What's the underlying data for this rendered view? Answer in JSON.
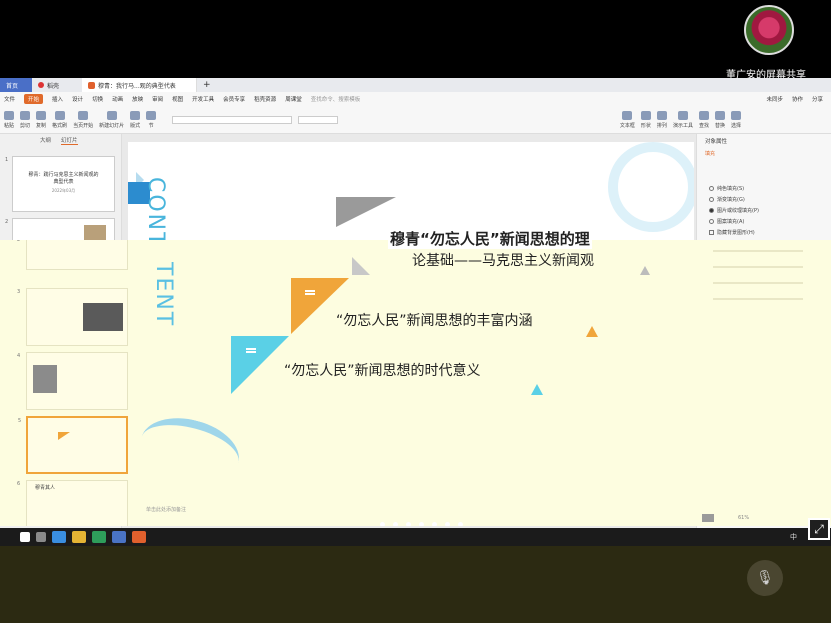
{
  "meeting": {
    "share_label": "董广安的屏幕共享"
  },
  "window": {
    "tabs": [
      "首页",
      "稻壳",
      "穆青：我行马...观的典型代表"
    ],
    "menu": [
      "文件",
      "开始",
      "插入",
      "设计",
      "切换",
      "动画",
      "放映",
      "审阅",
      "视图",
      "开发工具",
      "会员专享",
      "稻壳资源",
      "周课堂"
    ],
    "active_menu": "开始",
    "search_placeholder": "查找命令、搜索模板",
    "ribbon_left": [
      "粘贴",
      "剪切",
      "复制",
      "格式刷",
      "当页开始",
      "新建幻灯片",
      "版式",
      "节"
    ],
    "ribbon_right": [
      "文本框",
      "形状",
      "排列",
      "演示工具",
      "查找",
      "替换",
      "选择"
    ],
    "top_right": [
      "未同步",
      "协作",
      "分享"
    ]
  },
  "left_panel": {
    "tabs": [
      "大纲",
      "幻灯片"
    ],
    "slide1_title": "穆青：践行马克思主义新闻观的典型代表",
    "slide1_sub": "2022年03月"
  },
  "slide": {
    "side_word": "CONTENT",
    "item1_line1": "穆青“勿忘人民”新闻思想的理",
    "item1_line2": "论基础——马克思主义新闻观",
    "item2": "“勿忘人民”新闻思想的丰富内涵",
    "item3": "“勿忘人民”新闻思想的时代意义",
    "ov_thumb_title": "穆青其人"
  },
  "right_panel": {
    "title": "对象属性",
    "fill_label": "填充",
    "options": [
      "纯色填充(S)",
      "渐变填充(G)",
      "图片或纹理填充(P)",
      "图案填充(A)",
      "隐藏背景图形(H)"
    ],
    "selected_option": 2
  },
  "status": {
    "notes": "单击此处添加备注",
    "zoom": "61%"
  },
  "colors": {
    "accent_orange": "#f0a53a",
    "accent_cyan": "#5ad0e6",
    "accent_gray": "#9a9a9a",
    "wps_orange": "#e06a2b",
    "overlay_bg": "#fdfde0"
  }
}
